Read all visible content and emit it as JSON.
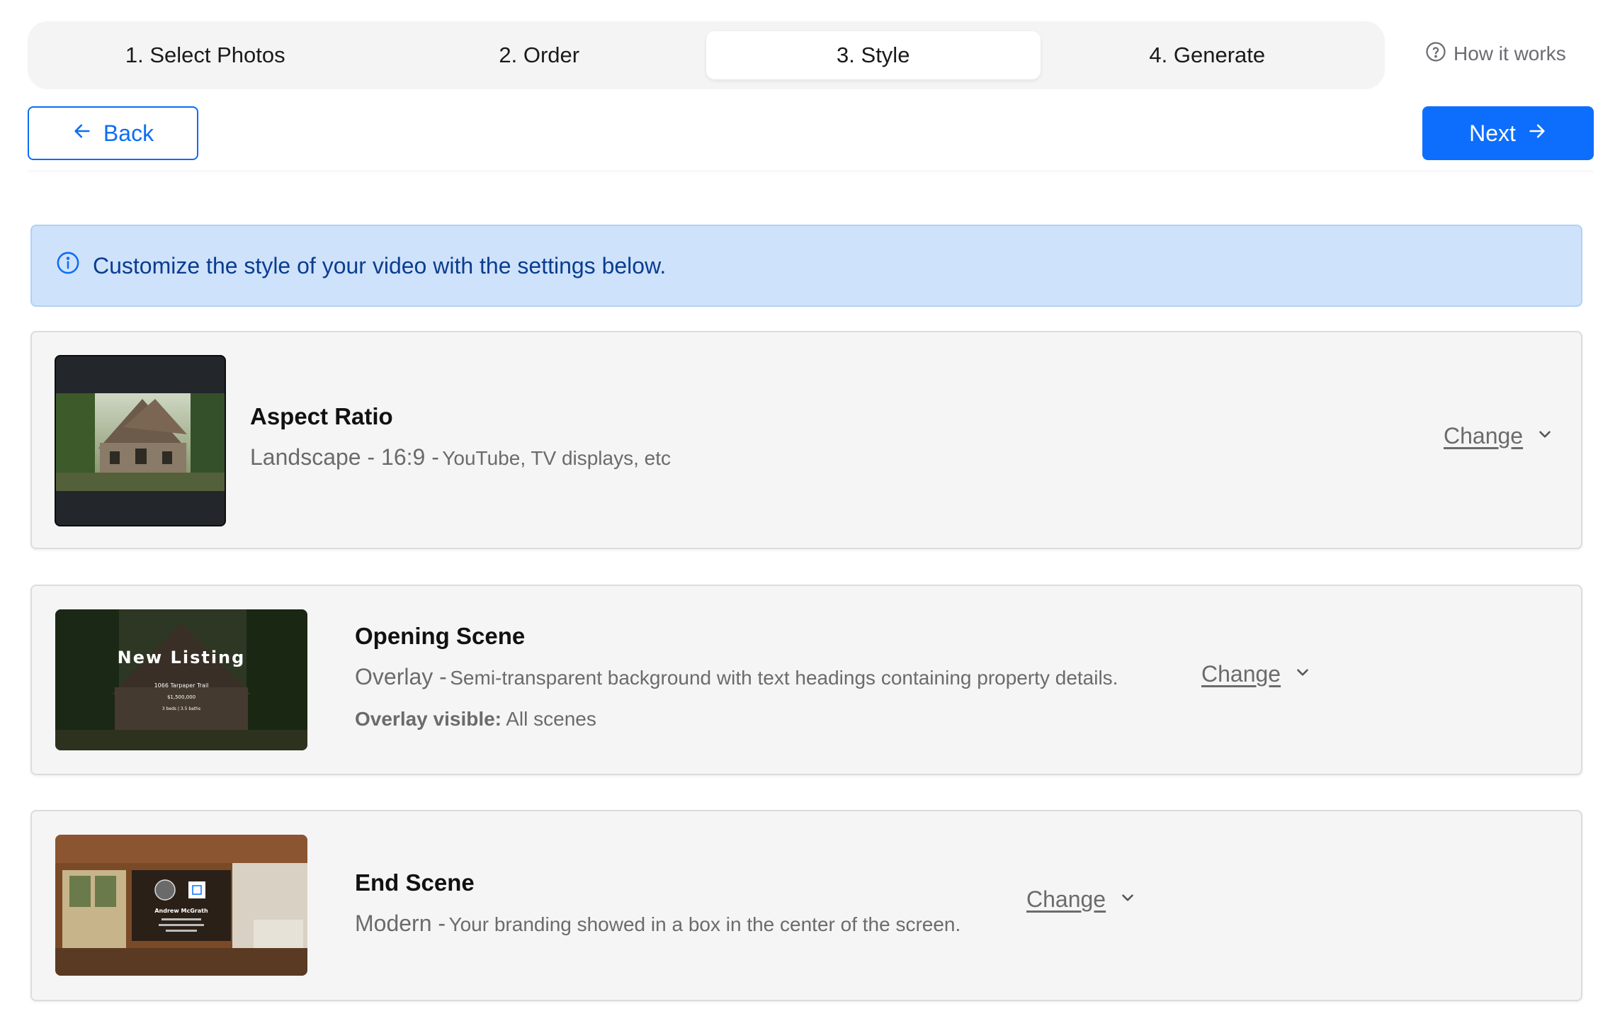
{
  "stepper": {
    "steps": [
      {
        "label": "1. Select Photos"
      },
      {
        "label": "2. Order"
      },
      {
        "label": "3. Style"
      },
      {
        "label": "4. Generate"
      }
    ],
    "active_index": 2,
    "how_it_works": "How it works"
  },
  "toolbar": {
    "back_label": "Back",
    "next_label": "Next"
  },
  "alert": {
    "text": "Customize the style of your video with the settings below."
  },
  "cards": {
    "aspect": {
      "title": "Aspect Ratio",
      "value": "Landscape - 16:9 -",
      "detail": "YouTube, TV displays, etc",
      "change": "Change"
    },
    "opening": {
      "title": "Opening Scene",
      "value": "Overlay -",
      "detail": "Semi-transparent background with text headings containing property details.",
      "extra_label": "Overlay visible:",
      "extra_value": "All scenes",
      "change": "Change",
      "thumb_heading": "New Listing",
      "thumb_address": "1066 Tarpaper Trail",
      "thumb_price": "$1,500,000",
      "thumb_specs": "3 beds | 3.5 baths"
    },
    "end": {
      "title": "End Scene",
      "value": "Modern -",
      "detail": "Your branding showed in a box in the center of the screen.",
      "change": "Change",
      "thumb_name": "Andrew McGrath"
    }
  },
  "colors": {
    "primary": "#0d6efd",
    "alert_bg": "#cfe2fb",
    "alert_text": "#0a3d8f",
    "card_bg": "#f5f5f5"
  }
}
